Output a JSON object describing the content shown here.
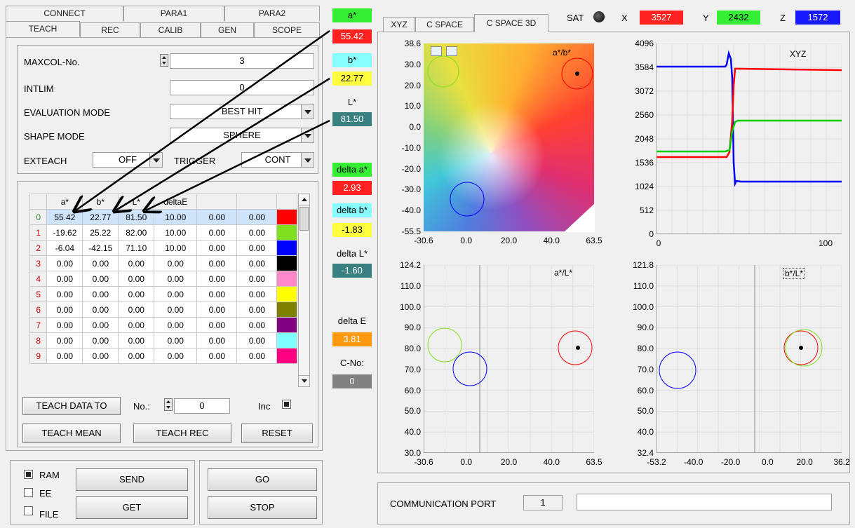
{
  "left_tabs": {
    "row1": [
      "CONNECT",
      "PARA1",
      "PARA2"
    ],
    "row2": [
      "TEACH",
      "REC",
      "CALIB",
      "GEN",
      "SCOPE"
    ]
  },
  "params": {
    "maxcol_label": "MAXCOL-No.",
    "maxcol_value": "3",
    "intlim_label": "INTLIM",
    "intlim_value": "0",
    "eval_label": "EVALUATION MODE",
    "eval_value": "BEST HIT",
    "shape_label": "SHAPE MODE",
    "shape_value": "SPHERE",
    "exteach_label": "EXTEACH",
    "exteach_value": "OFF",
    "trigger_label": "TRIGGER",
    "trigger_value": "CONT"
  },
  "table": {
    "headers": [
      "a*",
      "b*",
      "L*",
      "deltaE",
      "",
      ""
    ],
    "rows": [
      {
        "n": "0",
        "a": "55.42",
        "b": "22.77",
        "l": "81.50",
        "de": "10.00",
        "c5": "0.00",
        "c6": "0.00",
        "color": "#ff0000"
      },
      {
        "n": "1",
        "a": "-19.62",
        "b": "25.22",
        "l": "82.00",
        "de": "10.00",
        "c5": "0.00",
        "c6": "0.00",
        "color": "#80e020"
      },
      {
        "n": "2",
        "a": "-6.04",
        "b": "-42.15",
        "l": "71.10",
        "de": "10.00",
        "c5": "0.00",
        "c6": "0.00",
        "color": "#0000ff"
      },
      {
        "n": "3",
        "a": "0.00",
        "b": "0.00",
        "l": "0.00",
        "de": "0.00",
        "c5": "0.00",
        "c6": "0.00",
        "color": "#000000"
      },
      {
        "n": "4",
        "a": "0.00",
        "b": "0.00",
        "l": "0.00",
        "de": "0.00",
        "c5": "0.00",
        "c6": "0.00",
        "color": "#ff88c8"
      },
      {
        "n": "5",
        "a": "0.00",
        "b": "0.00",
        "l": "0.00",
        "de": "0.00",
        "c5": "0.00",
        "c6": "0.00",
        "color": "#ffff00"
      },
      {
        "n": "6",
        "a": "0.00",
        "b": "0.00",
        "l": "0.00",
        "de": "0.00",
        "c5": "0.00",
        "c6": "0.00",
        "color": "#808000"
      },
      {
        "n": "7",
        "a": "0.00",
        "b": "0.00",
        "l": "0.00",
        "de": "0.00",
        "c5": "0.00",
        "c6": "0.00",
        "color": "#800080"
      },
      {
        "n": "8",
        "a": "0.00",
        "b": "0.00",
        "l": "0.00",
        "de": "0.00",
        "c5": "0.00",
        "c6": "0.00",
        "color": "#80ffff"
      },
      {
        "n": "9",
        "a": "0.00",
        "b": "0.00",
        "l": "0.00",
        "de": "0.00",
        "c5": "0.00",
        "c6": "0.00",
        "color": "#ff0080"
      }
    ]
  },
  "teach": {
    "teach_data_to": "TEACH DATA TO",
    "no_label": "No.:",
    "no_value": "0",
    "inc_label": "Inc",
    "teach_mean": "TEACH MEAN",
    "teach_rec": "TEACH REC",
    "reset": "RESET"
  },
  "bottom": {
    "ram": "RAM",
    "ee": "EE",
    "file": "FILE",
    "send": "SEND",
    "get": "GET",
    "go": "GO",
    "stop": "STOP"
  },
  "values": {
    "a_label": "a*",
    "a_value": "55.42",
    "b_label": "b*",
    "b_value": "22.77",
    "l_label": "L*",
    "l_value": "81.50",
    "da_label": "delta a*",
    "da_value": "2.93",
    "db_label": "delta b*",
    "db_value": "-1.83",
    "dl_label": "delta L*",
    "dl_value": "-1.60",
    "de_label": "delta E",
    "de_value": "3.81",
    "cno_label": "C-No:",
    "cno_value": "0"
  },
  "right_tabs": [
    "XYZ",
    "C SPACE",
    "C SPACE 3D"
  ],
  "status": {
    "sat": "SAT",
    "x_label": "X",
    "x_value": "3527",
    "y_label": "Y",
    "y_value": "2432",
    "z_label": "Z",
    "z_value": "1572"
  },
  "plots": {
    "ab": {
      "title": "a*/b*",
      "y_ticks": [
        "38.6",
        "30.0",
        "20.0",
        "10.0",
        "0.0",
        "-10.0",
        "-20.0",
        "-30.0",
        "-40.0",
        "-55.5"
      ],
      "x_ticks": [
        "-30.6",
        "0.0",
        "20.0",
        "40.0",
        "63.5"
      ]
    },
    "xyz": {
      "title": "XYZ",
      "y_ticks": [
        "4096",
        "3584",
        "3072",
        "2560",
        "2048",
        "1536",
        "1024",
        "512",
        "0"
      ],
      "x_ticks": [
        "0",
        "100"
      ]
    },
    "al": {
      "title": "a*/L*",
      "y_ticks": [
        "124.2",
        "110.0",
        "100.0",
        "90.0",
        "80.0",
        "70.0",
        "60.0",
        "50.0",
        "40.0",
        "30.0"
      ],
      "x_ticks": [
        "-30.6",
        "0.0",
        "20.0",
        "40.0",
        "63.5"
      ]
    },
    "bl": {
      "title": "b*/L*",
      "y_ticks": [
        "121.8",
        "110.0",
        "100.0",
        "90.0",
        "80.0",
        "70.0",
        "60.0",
        "50.0",
        "40.0",
        "32.4"
      ],
      "x_ticks": [
        "-53.2",
        "-40.0",
        "-20.0",
        "0.0",
        "20.0",
        "36.2"
      ]
    }
  },
  "comm": {
    "label": "COMMUNICATION PORT",
    "port": "1",
    "status": ""
  },
  "colors": {
    "red": "#ff0000",
    "green": "#00cc00",
    "blue": "#0000ff"
  }
}
